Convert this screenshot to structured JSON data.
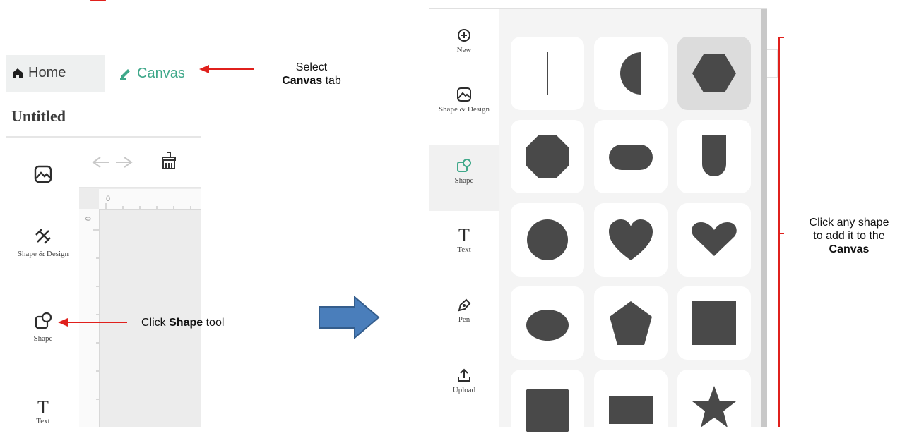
{
  "left_app": {
    "tabs": [
      {
        "label": "Home",
        "icon": "home-icon"
      },
      {
        "label": "Canvas",
        "icon": "pencil-icon"
      }
    ],
    "doc_title": "Untitled",
    "ruler": {
      "h_start": "0",
      "v_start": "0"
    },
    "sidebar": [
      {
        "label": "",
        "icon": "image-icon"
      },
      {
        "label": "Shape & Design",
        "icon": "design-icon"
      },
      {
        "label": "Shape",
        "icon": "shape-icon"
      },
      {
        "label": "Text",
        "icon": "text-icon"
      }
    ],
    "toolbar": {
      "undo": "undo-icon",
      "redo": "redo-icon",
      "clean": "cleanup-icon"
    }
  },
  "annotations": {
    "select_line1": "Select",
    "select_bold": "Canvas",
    "select_rest": "tab",
    "click_prefix": "Click",
    "click_bold": "Shape",
    "click_suffix": "tool",
    "any_line1": "Click any shape",
    "any_line2": "to add it to the",
    "any_bold": "Canvas"
  },
  "right_app": {
    "nav": [
      {
        "label": "New",
        "icon": "plus-circle-icon",
        "active": false
      },
      {
        "label": "Shape & Design",
        "icon": "image-icon",
        "active": false
      },
      {
        "label": "Shape",
        "icon": "shape-icon",
        "active": true
      },
      {
        "label": "Text",
        "icon": "text-icon",
        "active": false
      },
      {
        "label": "Pen",
        "icon": "pen-icon",
        "active": false
      },
      {
        "label": "Upload",
        "icon": "upload-icon",
        "active": false
      }
    ],
    "shapes": [
      "line",
      "half-circle",
      "hexagon",
      "octagon",
      "rounded-rectangle",
      "arch",
      "circle",
      "heart",
      "heart-wide",
      "ellipse",
      "pentagon",
      "square",
      "rounded-square",
      "rectangle",
      "star"
    ],
    "selected_shape": "hexagon"
  },
  "colors": {
    "accent": "#3fa88a",
    "annotation_red": "#e0201c",
    "arrow_blue": "#4a7ebb",
    "shape_fill": "#494949"
  }
}
